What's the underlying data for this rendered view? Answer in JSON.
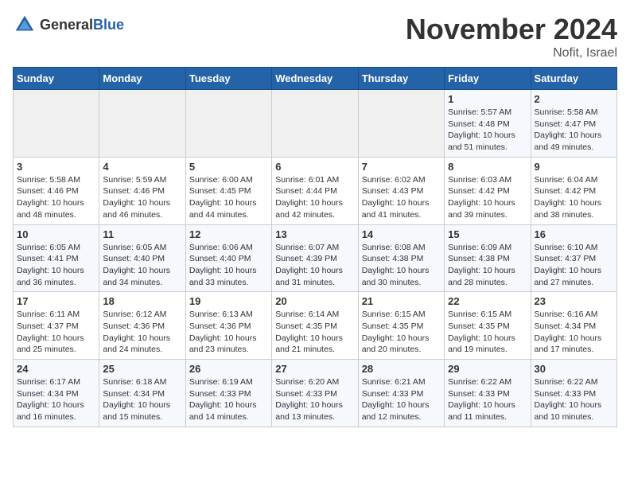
{
  "logo": {
    "general": "General",
    "blue": "Blue"
  },
  "title": "November 2024",
  "location": "Nofit, Israel",
  "days_of_week": [
    "Sunday",
    "Monday",
    "Tuesday",
    "Wednesday",
    "Thursday",
    "Friday",
    "Saturday"
  ],
  "weeks": [
    [
      {
        "day": "",
        "info": ""
      },
      {
        "day": "",
        "info": ""
      },
      {
        "day": "",
        "info": ""
      },
      {
        "day": "",
        "info": ""
      },
      {
        "day": "",
        "info": ""
      },
      {
        "day": "1",
        "info": "Sunrise: 5:57 AM\nSunset: 4:48 PM\nDaylight: 10 hours\nand 51 minutes."
      },
      {
        "day": "2",
        "info": "Sunrise: 5:58 AM\nSunset: 4:47 PM\nDaylight: 10 hours\nand 49 minutes."
      }
    ],
    [
      {
        "day": "3",
        "info": "Sunrise: 5:58 AM\nSunset: 4:46 PM\nDaylight: 10 hours\nand 48 minutes."
      },
      {
        "day": "4",
        "info": "Sunrise: 5:59 AM\nSunset: 4:46 PM\nDaylight: 10 hours\nand 46 minutes."
      },
      {
        "day": "5",
        "info": "Sunrise: 6:00 AM\nSunset: 4:45 PM\nDaylight: 10 hours\nand 44 minutes."
      },
      {
        "day": "6",
        "info": "Sunrise: 6:01 AM\nSunset: 4:44 PM\nDaylight: 10 hours\nand 42 minutes."
      },
      {
        "day": "7",
        "info": "Sunrise: 6:02 AM\nSunset: 4:43 PM\nDaylight: 10 hours\nand 41 minutes."
      },
      {
        "day": "8",
        "info": "Sunrise: 6:03 AM\nSunset: 4:42 PM\nDaylight: 10 hours\nand 39 minutes."
      },
      {
        "day": "9",
        "info": "Sunrise: 6:04 AM\nSunset: 4:42 PM\nDaylight: 10 hours\nand 38 minutes."
      }
    ],
    [
      {
        "day": "10",
        "info": "Sunrise: 6:05 AM\nSunset: 4:41 PM\nDaylight: 10 hours\nand 36 minutes."
      },
      {
        "day": "11",
        "info": "Sunrise: 6:05 AM\nSunset: 4:40 PM\nDaylight: 10 hours\nand 34 minutes."
      },
      {
        "day": "12",
        "info": "Sunrise: 6:06 AM\nSunset: 4:40 PM\nDaylight: 10 hours\nand 33 minutes."
      },
      {
        "day": "13",
        "info": "Sunrise: 6:07 AM\nSunset: 4:39 PM\nDaylight: 10 hours\nand 31 minutes."
      },
      {
        "day": "14",
        "info": "Sunrise: 6:08 AM\nSunset: 4:38 PM\nDaylight: 10 hours\nand 30 minutes."
      },
      {
        "day": "15",
        "info": "Sunrise: 6:09 AM\nSunset: 4:38 PM\nDaylight: 10 hours\nand 28 minutes."
      },
      {
        "day": "16",
        "info": "Sunrise: 6:10 AM\nSunset: 4:37 PM\nDaylight: 10 hours\nand 27 minutes."
      }
    ],
    [
      {
        "day": "17",
        "info": "Sunrise: 6:11 AM\nSunset: 4:37 PM\nDaylight: 10 hours\nand 25 minutes."
      },
      {
        "day": "18",
        "info": "Sunrise: 6:12 AM\nSunset: 4:36 PM\nDaylight: 10 hours\nand 24 minutes."
      },
      {
        "day": "19",
        "info": "Sunrise: 6:13 AM\nSunset: 4:36 PM\nDaylight: 10 hours\nand 23 minutes."
      },
      {
        "day": "20",
        "info": "Sunrise: 6:14 AM\nSunset: 4:35 PM\nDaylight: 10 hours\nand 21 minutes."
      },
      {
        "day": "21",
        "info": "Sunrise: 6:15 AM\nSunset: 4:35 PM\nDaylight: 10 hours\nand 20 minutes."
      },
      {
        "day": "22",
        "info": "Sunrise: 6:15 AM\nSunset: 4:35 PM\nDaylight: 10 hours\nand 19 minutes."
      },
      {
        "day": "23",
        "info": "Sunrise: 6:16 AM\nSunset: 4:34 PM\nDaylight: 10 hours\nand 17 minutes."
      }
    ],
    [
      {
        "day": "24",
        "info": "Sunrise: 6:17 AM\nSunset: 4:34 PM\nDaylight: 10 hours\nand 16 minutes."
      },
      {
        "day": "25",
        "info": "Sunrise: 6:18 AM\nSunset: 4:34 PM\nDaylight: 10 hours\nand 15 minutes."
      },
      {
        "day": "26",
        "info": "Sunrise: 6:19 AM\nSunset: 4:33 PM\nDaylight: 10 hours\nand 14 minutes."
      },
      {
        "day": "27",
        "info": "Sunrise: 6:20 AM\nSunset: 4:33 PM\nDaylight: 10 hours\nand 13 minutes."
      },
      {
        "day": "28",
        "info": "Sunrise: 6:21 AM\nSunset: 4:33 PM\nDaylight: 10 hours\nand 12 minutes."
      },
      {
        "day": "29",
        "info": "Sunrise: 6:22 AM\nSunset: 4:33 PM\nDaylight: 10 hours\nand 11 minutes."
      },
      {
        "day": "30",
        "info": "Sunrise: 6:22 AM\nSunset: 4:33 PM\nDaylight: 10 hours\nand 10 minutes."
      }
    ]
  ]
}
